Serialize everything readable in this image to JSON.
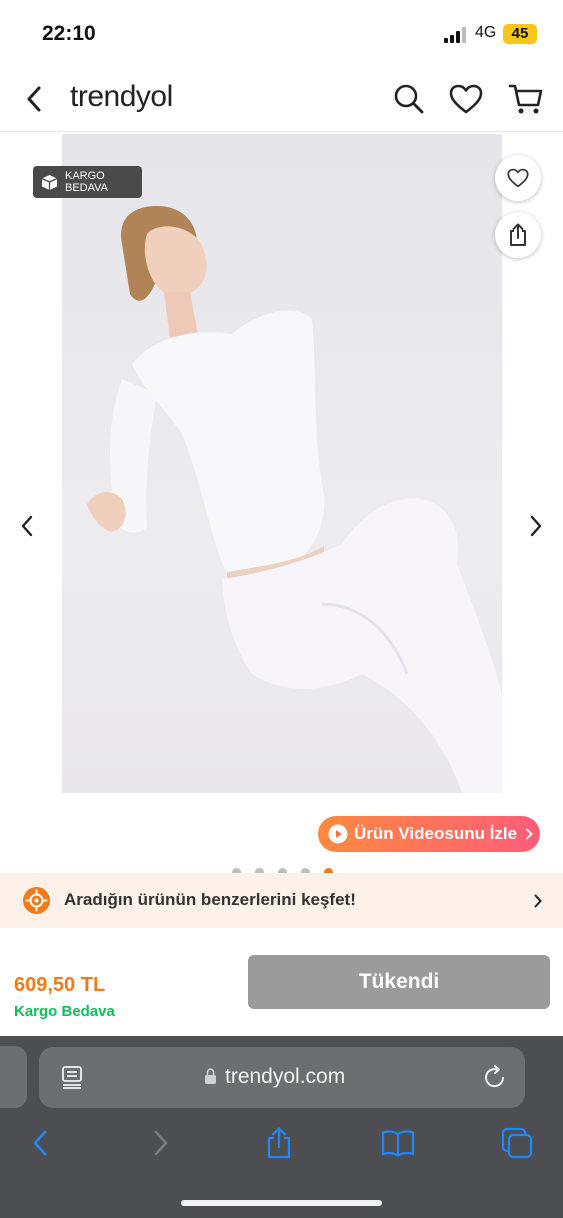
{
  "status_bar": {
    "time": "22:10",
    "network": "4G",
    "battery": "45"
  },
  "header": {
    "logo": "trendyol",
    "back_icon": "chevron-left-icon",
    "search_icon": "search-icon",
    "favorites_icon": "heart-icon",
    "cart_icon": "cart-icon"
  },
  "gallery": {
    "badge_line1": "KARGO",
    "badge_line2": "BEDAVA",
    "video_button": "Ürün Videosunu İzle",
    "image_count": 5,
    "active_index": 4
  },
  "similar_banner": {
    "text": "Aradığın ürünün benzerlerini keşfet!"
  },
  "purchase": {
    "price": "609,50 TL",
    "shipping": "Kargo Bedava",
    "button": "Tükendi"
  },
  "browser": {
    "url": "trendyol.com"
  },
  "colors": {
    "brand_orange": "#f27a1a",
    "free_shipping_green": "#0bc15c",
    "safari_blue": "#1e88ff"
  }
}
